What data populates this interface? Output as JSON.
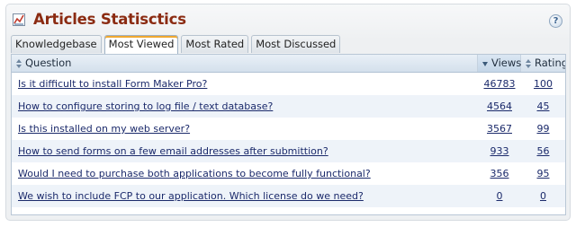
{
  "header": {
    "title": "Articles Statisctics",
    "help_label": "?"
  },
  "tabs": [
    {
      "label": "Knowledgebase",
      "active": false
    },
    {
      "label": "Most Viewed",
      "active": true
    },
    {
      "label": "Most Rated",
      "active": false
    },
    {
      "label": "Most Discussed",
      "active": false
    }
  ],
  "table": {
    "columns": {
      "question": "Question",
      "views": "Views",
      "rating": "Rating"
    },
    "sorted_by": "views",
    "rows": [
      {
        "question": "Is it difficult to install Form Maker Pro?",
        "views": "46783",
        "rating": "100"
      },
      {
        "question": "How to configure storing to log file / text database?",
        "views": "4564",
        "rating": "45"
      },
      {
        "question": "Is this installed on my web server?",
        "views": "3567",
        "rating": "99"
      },
      {
        "question": "How to send forms on a few email addresses after submittion?",
        "views": "933",
        "rating": "56"
      },
      {
        "question": "Would I need to purchase both applications to become fully functional?",
        "views": "356",
        "rating": "95"
      },
      {
        "question": "We wish to include FCP to our application. Which license do we need?",
        "views": "0",
        "rating": "0"
      }
    ]
  },
  "colors": {
    "title": "#8b2b12",
    "link": "#1b2a6b",
    "active_tab_accent": "#f0a830",
    "row_alt": "#eef3f9"
  }
}
